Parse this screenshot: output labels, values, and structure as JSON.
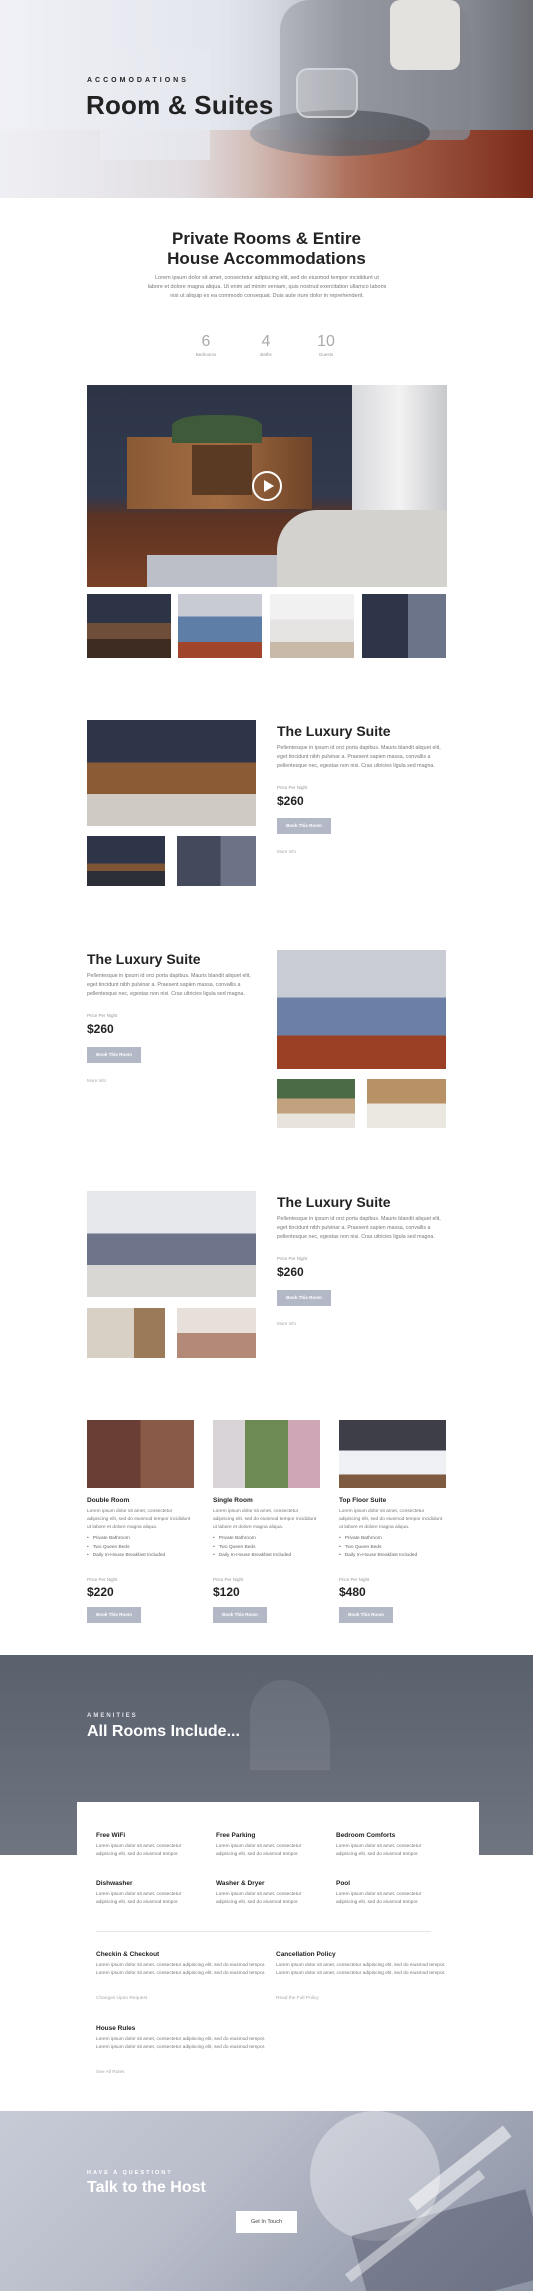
{
  "hero": {
    "eyebrow": "ACCOMODATIONS",
    "title": "Room & Suites"
  },
  "intro": {
    "title_line1": "Private Rooms & Entire",
    "title_line2": "House Accommodations",
    "text": "Lorem ipsum dolor sit amet, consectetur adipiscing elit, sed do eiusmod tempor incididunt ut labore et dolore magna aliqua. Ut enim ad minim veniam, quis nostrud exercitation ullamco laboris nisi ut aliquip ex ea commodo consequat. Duis aute irure dolor in reprehenderit.",
    "stats": [
      {
        "value": "6",
        "label": "Bedrooms"
      },
      {
        "value": "4",
        "label": "Baths"
      },
      {
        "value": "10",
        "label": "Guests"
      }
    ]
  },
  "video": {
    "icon": "play-icon"
  },
  "rooms": [
    {
      "title": "The Luxury Suite",
      "text": "Pellentesque in ipsum id orci porta dapibus. Mauris blandit aliquet elit, eget tincidunt nibh pulvinar a. Praesent sapien massa, convallis a pellentesque nec, egestas non nisi. Cras ultricies ligula sed magna.",
      "price_label": "Price Per Night",
      "price": "$260",
      "button": "Book This Room",
      "more": "More Info"
    },
    {
      "title": "The Luxury Suite",
      "text": "Pellentesque in ipsum id orci porta dapibus. Mauris blandit aliquet elit, eget tincidunt nibh pulvinar a. Praesent sapien massa, convallis a pellentesque nec, egestas non nisi. Cras ultricies ligula sed magna.",
      "price_label": "Price Per Night",
      "price": "$260",
      "button": "Book This Room",
      "more": "More Info"
    },
    {
      "title": "The Luxury Suite",
      "text": "Pellentesque in ipsum id orci porta dapibus. Mauris blandit aliquet elit, eget tincidunt nibh pulvinar a. Praesent sapien massa, convallis a pellentesque nec, egestas non nisi. Cras ultricies ligula sed magna.",
      "price_label": "Price Per Night",
      "price": "$260",
      "button": "Book This Room",
      "more": "More Info"
    }
  ],
  "cards": [
    {
      "title": "Double Room",
      "text": "Lorem ipsum dolor sit amet, consectetur adipiscing elit, sed do eiusmod tempor incididunt ut labore et dolore magna aliqua.",
      "features": [
        "Private Bathroom",
        "Two Queen Beds",
        "Daily In-House Breakfast Included"
      ],
      "price_label": "Price Per Night",
      "price": "$220",
      "button": "Book This Room"
    },
    {
      "title": "Single Room",
      "text": "Lorem ipsum dolor sit amet, consectetur adipiscing elit, sed do eiusmod tempor incididunt ut labore et dolore magna aliqua.",
      "features": [
        "Private Bathroom",
        "Two Queen Beds",
        "Daily In-House Breakfast Included"
      ],
      "price_label": "Price Per Night",
      "price": "$120",
      "button": "Book This Room"
    },
    {
      "title": "Top Floor Suite",
      "text": "Lorem ipsum dolor sit amet, consectetur adipiscing elit, sed do eiusmod tempor incididunt ut labore et dolore magna aliqua.",
      "features": [
        "Private Bathroom",
        "Two Queen Beds",
        "Daily In-House Breakfast Included"
      ],
      "price_label": "Price Per Night",
      "price": "$480",
      "button": "Book This Room"
    }
  ],
  "amenities": {
    "eyebrow": "AMENITIES",
    "title": "All Rooms Include...",
    "items": [
      {
        "title": "Free WiFi",
        "text": "Lorem ipsum dolor sit amet, consectetur adipiscing elit, sed do eiusmod tempor."
      },
      {
        "title": "Free Parking",
        "text": "Lorem ipsum dolor sit amet, consectetur adipiscing elit, sed do eiusmod tempor."
      },
      {
        "title": "Bedroom Comforts",
        "text": "Lorem ipsum dolor sit amet, consectetur adipiscing elit, sed do eiusmod tempor."
      },
      {
        "title": "Dishwasher",
        "text": "Lorem ipsum dolor sit amet, consectetur adipiscing elit, sed do eiusmod tempor."
      },
      {
        "title": "Washer & Dryer",
        "text": "Lorem ipsum dolor sit amet, consectetur adipiscing elit, sed do eiusmod tempor."
      },
      {
        "title": "Pool",
        "text": "Lorem ipsum dolor sit amet, consectetur adipiscing elit, sed do eiusmod tempor."
      }
    ],
    "policies": [
      {
        "title": "Checkin & Checkout",
        "text": "Lorem ipsum dolor sit amet, consectetur adipiscing elit, sed do eiusmod tempor. Lorem ipsum dolor sit amet, consectetur adipiscing elit, sed do eiusmod tempor.",
        "link": "Changes Upon Request"
      },
      {
        "title": "Cancellation Policy",
        "text": "Lorem ipsum dolor sit amet, consectetur adipiscing elit, sed do eiusmod tempor. Lorem ipsum dolor sit amet, consectetur adipiscing elit, sed do eiusmod tempor.",
        "link": "Read the Full Policy"
      },
      {
        "title": "House Rules",
        "text": "Lorem ipsum dolor sit amet, consectetur adipiscing elit, sed do eiusmod tempor. Lorem ipsum dolor sit amet, consectetur adipiscing elit, sed do eiusmod tempor.",
        "link": "See All Rules"
      }
    ]
  },
  "host": {
    "eyebrow": "HAVE A QUESTION?",
    "title": "Talk to the Host",
    "button": "Get In Touch"
  },
  "colors": {
    "button": "#b3b8c6",
    "amenities_bg": "#5f6773",
    "heading": "#222222"
  }
}
